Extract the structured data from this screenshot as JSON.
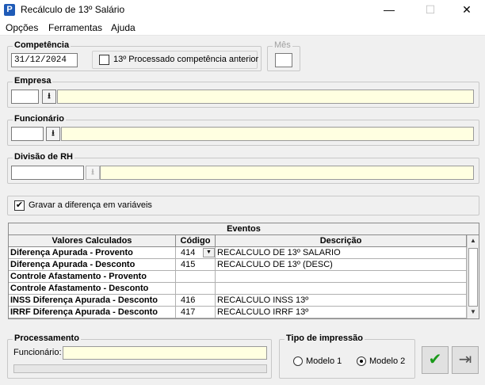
{
  "window": {
    "title": "Recálculo de 13º Salário",
    "icon_letter": "P",
    "minimize": "—",
    "maximize": "☐",
    "close": "✕"
  },
  "menu": {
    "items": [
      "Opções",
      "Ferramentas",
      "Ajuda"
    ]
  },
  "competencia": {
    "legend": "Competência",
    "value": "31/12/2024",
    "checkbox_label": "13º Processado competência anterior",
    "checkbox_checked": false
  },
  "mes": {
    "legend": "Mês",
    "value": ""
  },
  "empresa": {
    "legend": "Empresa",
    "code": "",
    "name": ""
  },
  "funcionario": {
    "legend": "Funcionário",
    "code": "",
    "name": ""
  },
  "divisao": {
    "legend": "Divisão de RH",
    "code": "",
    "name": ""
  },
  "gravar": {
    "label": "Gravar a diferença em variáveis",
    "checked": true,
    "check_glyph": "✔"
  },
  "eventos": {
    "title": "Eventos",
    "headers": [
      "Valores Calculados",
      "Código",
      "Descrição"
    ],
    "rows": [
      {
        "valor": "Diferença Apurada - Provento",
        "codigo": "414",
        "descricao": "RECALCULO DE 13º SALARIO"
      },
      {
        "valor": "Diferença Apurada - Desconto",
        "codigo": "415",
        "descricao": "RECALCULO DE 13º (DESC)"
      },
      {
        "valor": "Controle Afastamento - Provento",
        "codigo": "",
        "descricao": ""
      },
      {
        "valor": "Controle Afastamento - Desconto",
        "codigo": "",
        "descricao": ""
      },
      {
        "valor": "INSS Diferença Apurada - Desconto",
        "codigo": "416",
        "descricao": "RECALCULO  INSS 13º"
      },
      {
        "valor": "IRRF Diferença Apurada - Desconto",
        "codigo": "417",
        "descricao": "RECALCULO IRRF 13º"
      }
    ]
  },
  "processamento": {
    "legend": "Processamento",
    "funcionario_label": "Funcionário:",
    "funcionario_value": "",
    "progress": 0
  },
  "impressao": {
    "legend": "Tipo de impressão",
    "options": [
      "Modelo 1",
      "Modelo 2"
    ],
    "selected": "Modelo 2"
  },
  "actions": {
    "confirm_glyph": "✔",
    "exit_glyph": "⇥"
  }
}
